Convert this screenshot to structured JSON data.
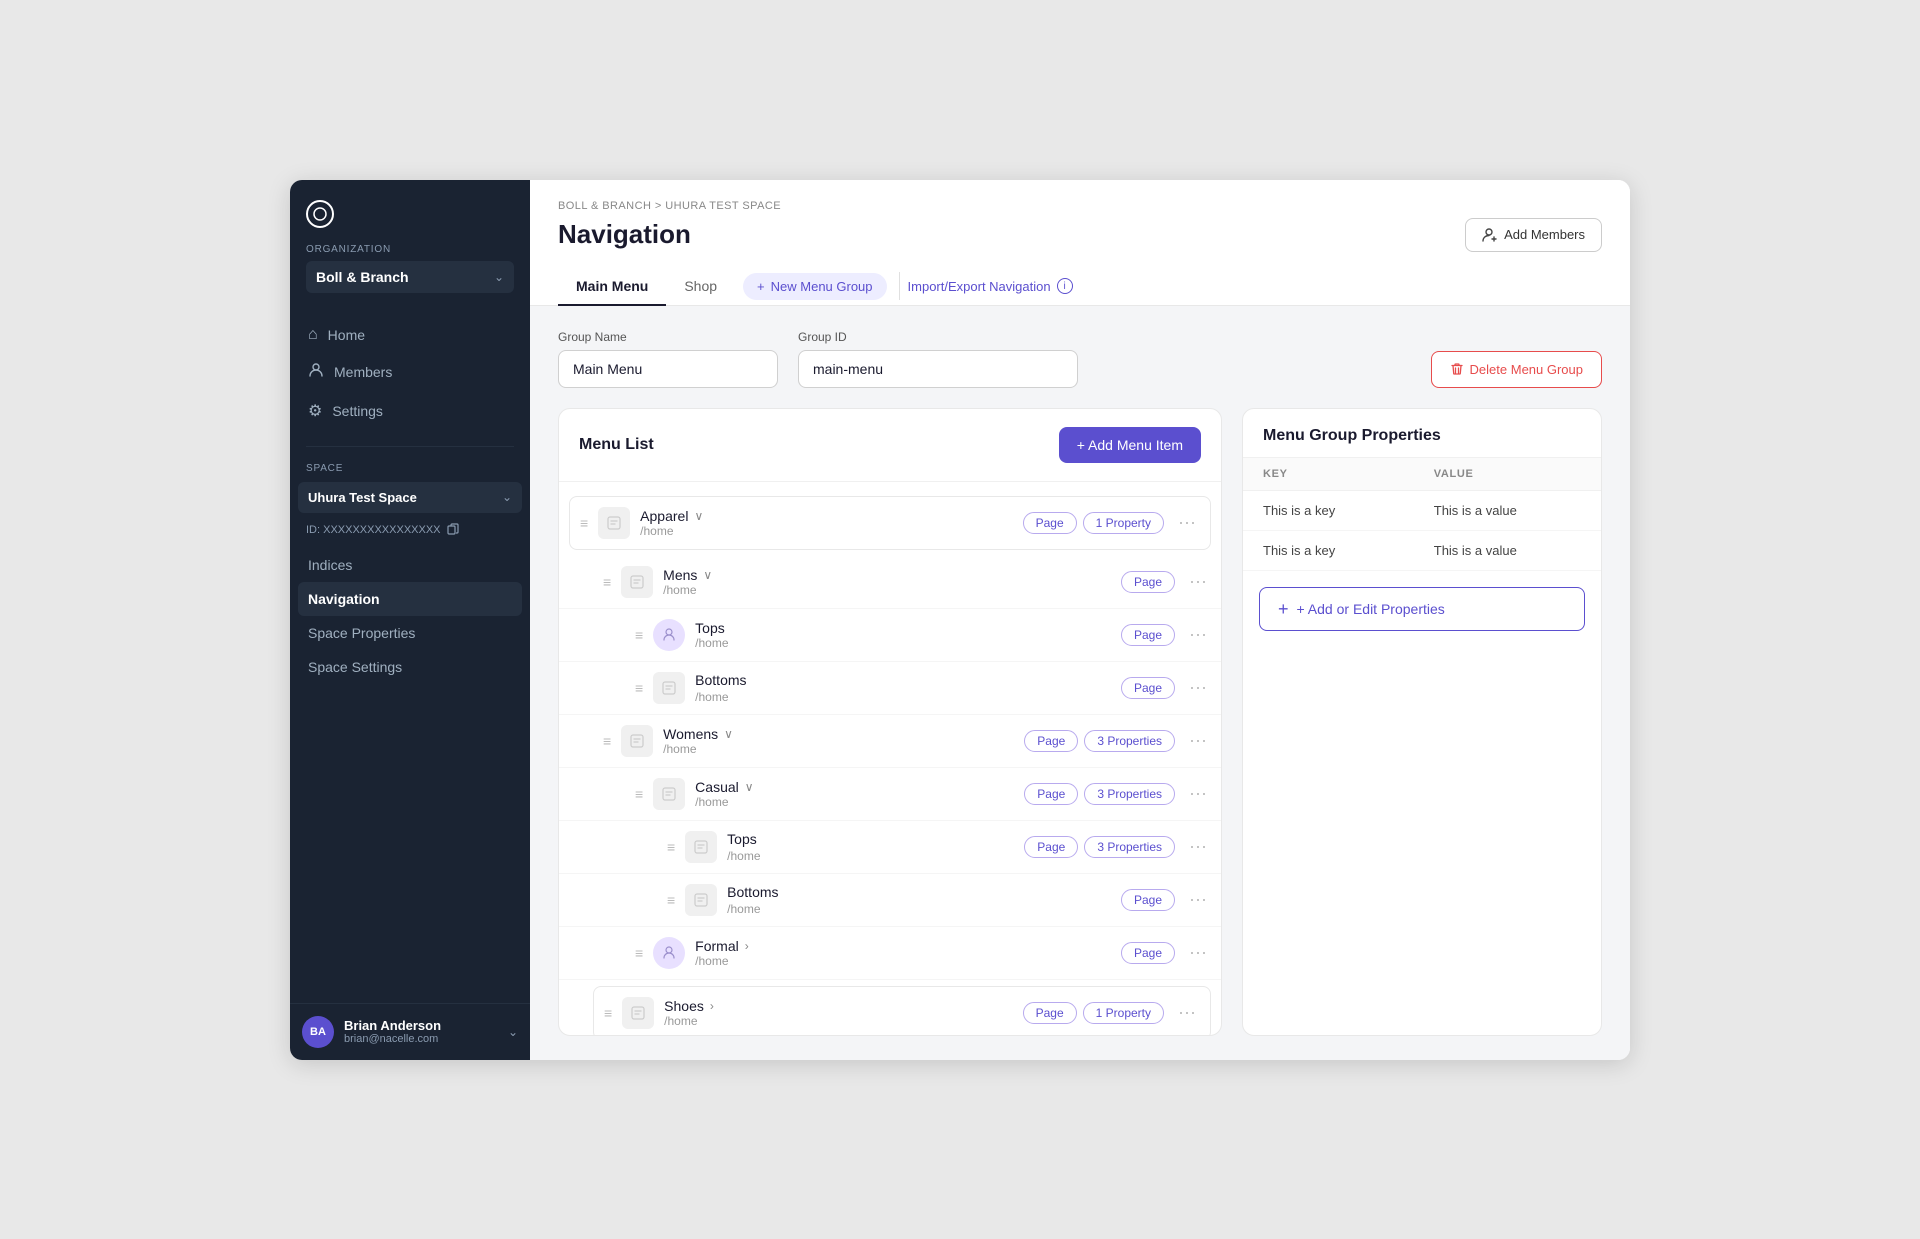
{
  "sidebar": {
    "logo_icon": "○",
    "org_label": "Organization",
    "org_name": "Boll & Branch",
    "nav_items": [
      {
        "id": "home",
        "label": "Home",
        "icon": "⌂"
      },
      {
        "id": "members",
        "label": "Members",
        "icon": "👤"
      },
      {
        "id": "settings",
        "label": "Settings",
        "icon": "⚙"
      }
    ],
    "space_label": "Space",
    "space_name": "Uhura Test Space",
    "space_id_label": "ID: XXXXXXXXXXXXXXXX",
    "space_nav_items": [
      {
        "id": "indices",
        "label": "Indices",
        "active": false
      },
      {
        "id": "navigation",
        "label": "Navigation",
        "active": true
      },
      {
        "id": "space-properties",
        "label": "Space Properties",
        "active": false
      },
      {
        "id": "space-settings",
        "label": "Space Settings",
        "active": false
      }
    ],
    "user": {
      "initials": "BA",
      "name": "Brian Anderson",
      "email": "brian@nacelle.com"
    }
  },
  "header": {
    "breadcrumb": "BOLL & BRANCH > UHURA TEST SPACE",
    "page_title": "Navigation",
    "add_members_label": "Add Members"
  },
  "tabs": [
    {
      "id": "main-menu",
      "label": "Main Menu",
      "active": true
    },
    {
      "id": "shop",
      "label": "Shop",
      "active": false
    }
  ],
  "new_menu_group_label": "New Menu Group",
  "import_export_label": "Import/Export Navigation",
  "form": {
    "group_name_label": "Group Name",
    "group_name_value": "Main Menu",
    "group_id_label": "Group ID",
    "group_id_value": "main-menu",
    "delete_btn_label": "Delete Menu Group"
  },
  "menu_list": {
    "title": "Menu List",
    "add_btn_label": "+ Add Menu Item",
    "items": [
      {
        "id": "apparel",
        "name": "Apparel",
        "path": "/home",
        "has_expand": true,
        "badges": [
          "Page",
          "1 Property"
        ],
        "thumb_type": "image",
        "highlighted": true
      },
      {
        "id": "mens",
        "name": "Mens",
        "path": "/home",
        "has_expand": true,
        "badges": [
          "Page"
        ],
        "thumb_type": "image",
        "indent": 1
      },
      {
        "id": "tops1",
        "name": "Tops",
        "path": "/home",
        "has_expand": false,
        "badges": [
          "Page"
        ],
        "thumb_type": "avatar",
        "indent": 2
      },
      {
        "id": "bottoms1",
        "name": "Bottoms",
        "path": "/home",
        "has_expand": false,
        "badges": [
          "Page"
        ],
        "thumb_type": "image",
        "indent": 2
      },
      {
        "id": "womens",
        "name": "Womens",
        "path": "/home",
        "has_expand": true,
        "badges": [
          "Page",
          "3 Properties"
        ],
        "thumb_type": "image",
        "indent": 1
      },
      {
        "id": "casual",
        "name": "Casual",
        "path": "/home",
        "has_expand": true,
        "badges": [
          "Page",
          "3 Properties"
        ],
        "thumb_type": "image",
        "indent": 2
      },
      {
        "id": "tops2",
        "name": "Tops",
        "path": "/home",
        "has_expand": false,
        "badges": [
          "Page",
          "3 Properties"
        ],
        "thumb_type": "image",
        "indent": 3
      },
      {
        "id": "bottoms2",
        "name": "Bottoms",
        "path": "/home",
        "has_expand": false,
        "badges": [
          "Page"
        ],
        "thumb_type": "image",
        "indent": 3
      },
      {
        "id": "formal",
        "name": "Formal",
        "path": "/home",
        "has_expand": true,
        "expand_right": true,
        "badges": [
          "Page"
        ],
        "thumb_type": "avatar",
        "indent": 2
      },
      {
        "id": "shoes",
        "name": "Shoes",
        "path": "/home",
        "has_expand": true,
        "expand_right": true,
        "badges": [
          "Page",
          "1 Property"
        ],
        "thumb_type": "image",
        "indent": 1,
        "highlighted": true
      }
    ]
  },
  "properties": {
    "title": "Menu Group Properties",
    "key_col": "KEY",
    "value_col": "VALUE",
    "rows": [
      {
        "key": "This is a key",
        "value": "This is a value"
      },
      {
        "key": "This is a key",
        "value": "This is a value"
      }
    ],
    "add_edit_label": "+ Add or Edit Properties"
  }
}
